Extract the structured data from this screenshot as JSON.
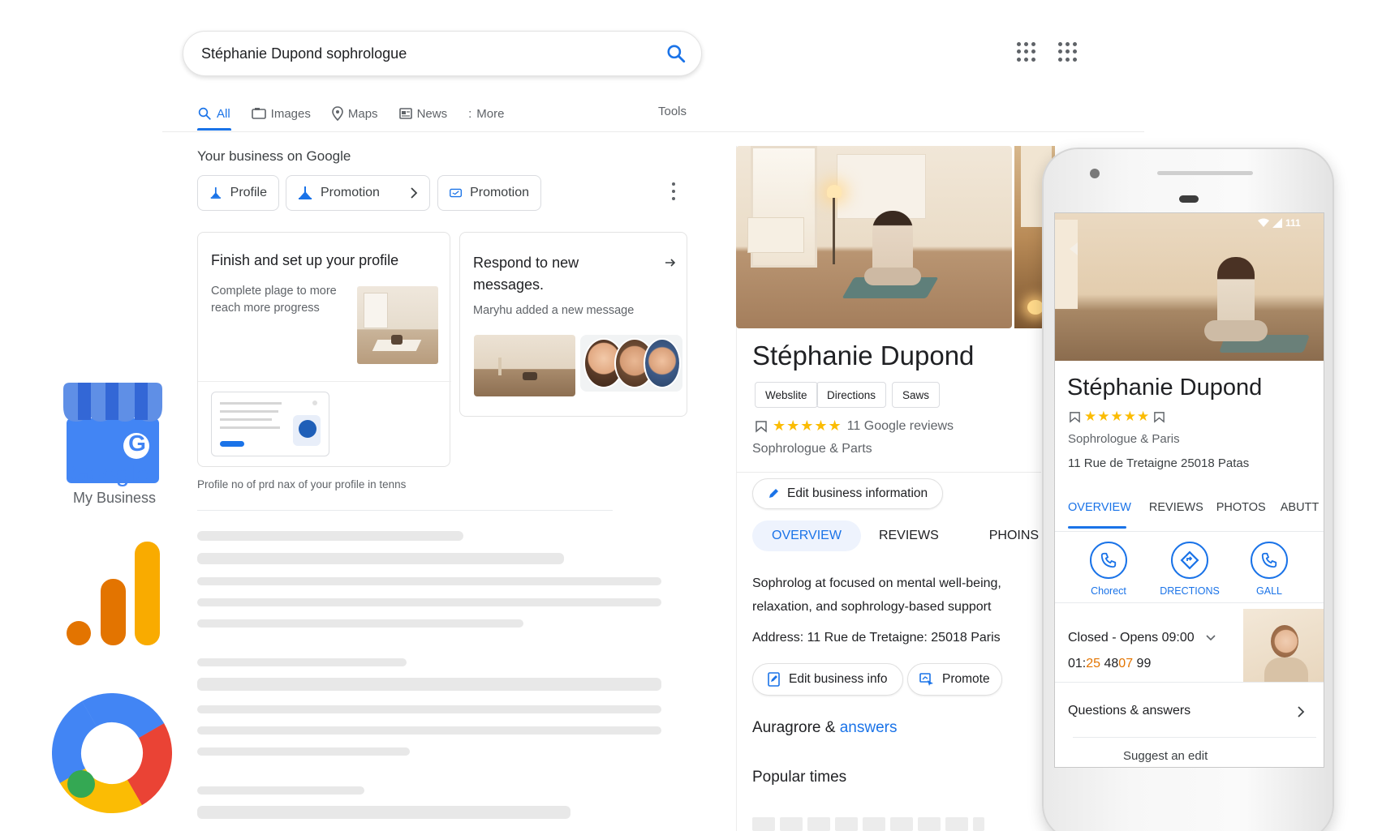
{
  "search": {
    "query": "Stéphanie Dupond sophrologue",
    "tabs": [
      {
        "label": "All",
        "icon": "search-icon"
      },
      {
        "label": "Images",
        "icon": "image-icon"
      },
      {
        "label": "Maps",
        "icon": "map-pin-icon"
      },
      {
        "label": "News",
        "icon": "news-icon"
      },
      {
        "label": "More",
        "icon": "more-dots-icon"
      }
    ],
    "more_prefix": ":",
    "tools_label": "Tools"
  },
  "business": {
    "heading": "Your business on Google",
    "chips": [
      {
        "label": "Profile",
        "icon": "profile-icon"
      },
      {
        "label": "Promotion",
        "icon": "promotion-icon"
      },
      {
        "label": "Promotion",
        "icon": "promotion-card-icon"
      }
    ],
    "card_setup": {
      "title": "Finish and set up your profile",
      "subtitle": "Complete plage to more reach more progress"
    },
    "card_messages": {
      "title": "Respond to new messages.",
      "subtitle": "Maryhu added a new message"
    },
    "caption": "Profile no of prd nax of your profile in tenns"
  },
  "knowledge_panel": {
    "name": "Stéphanie Dupond",
    "buttons": [
      "Webslite",
      "Directions",
      "Saws"
    ],
    "rating_stars": 4.5,
    "reviews_text": "11 Google reviews",
    "category": "Sophrologue & Parts",
    "edit_info_label": "Edit business information",
    "tabs": [
      "OVERVIEW",
      "REVIEWS",
      "PHOINS"
    ],
    "description": "Sophrolog at focused on mental well-being, relaxation, and sophrology-based support",
    "address": "Address: 11 Rue de Tretaigne: 25018 Paris",
    "edit_info_short": "Edit business info",
    "promote_label": "Promote",
    "qa_prefix": "Auragrore & ",
    "qa_link": "answers",
    "popular_times": "Popular times"
  },
  "phone": {
    "status_text": "111",
    "name": "Stéphanie Dupond",
    "rating_stars": 4.5,
    "category": "Sophrologue & Paris",
    "address": "11 Rue de Tretaigne 25018 Patas",
    "tabs": [
      "OVERVIEW",
      "REVIEWS",
      "PHOTOS",
      "ABUTT"
    ],
    "actions": [
      {
        "label": "Chorect",
        "icon": "phone-icon"
      },
      {
        "label": "DRECTIONS",
        "icon": "directions-icon"
      },
      {
        "label": "GALL",
        "icon": "phone-icon"
      }
    ],
    "hours": "Closed - Opens 09:00",
    "phone_number_a": "01:",
    "phone_number_b": "25",
    "phone_number_c": " 48",
    "phone_number_d": "07",
    "phone_number_e": " 99",
    "qa_label": "Questions & answers",
    "suggest_label": "Suggest an edit"
  },
  "logos": {
    "gmb_line1": "Google",
    "gmb_line2": "My Business",
    "gmb_badge": "G"
  },
  "colors": {
    "google_blue": "#1a73e8",
    "star_yellow": "#fbbc04",
    "analytics_orange": "#e37400",
    "analytics_yellow": "#f9ab00"
  }
}
